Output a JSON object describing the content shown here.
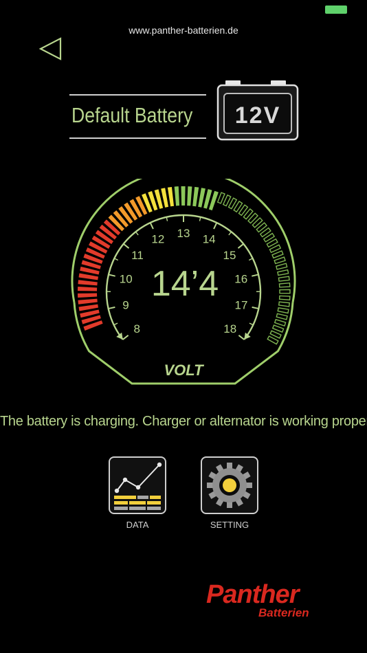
{
  "header": {
    "url": "www.panther-batterien.de"
  },
  "battery": {
    "name": "Default Battery",
    "voltage_badge": "12V"
  },
  "gauge": {
    "reading": "14’4",
    "value": 14.4,
    "min": 8,
    "max": 18,
    "unit_label": "VOLT",
    "ticks": [
      "8",
      "9",
      "10",
      "11",
      "12",
      "13",
      "14",
      "15",
      "16",
      "17",
      "18"
    ]
  },
  "status": {
    "message": "The battery is charging. Charger or alternator is working properly."
  },
  "buttons": {
    "data_label": "DATA",
    "setting_label": "SETTING"
  },
  "brand": {
    "logo_text_main": "Panther",
    "logo_text_sub": "Batterien"
  },
  "colors": {
    "accent_green": "#b8d58e",
    "segment_red": "#e23b2b",
    "segment_orange": "#f39a2a",
    "segment_yellow": "#f4e13c",
    "segment_green": "#8cc85a"
  }
}
